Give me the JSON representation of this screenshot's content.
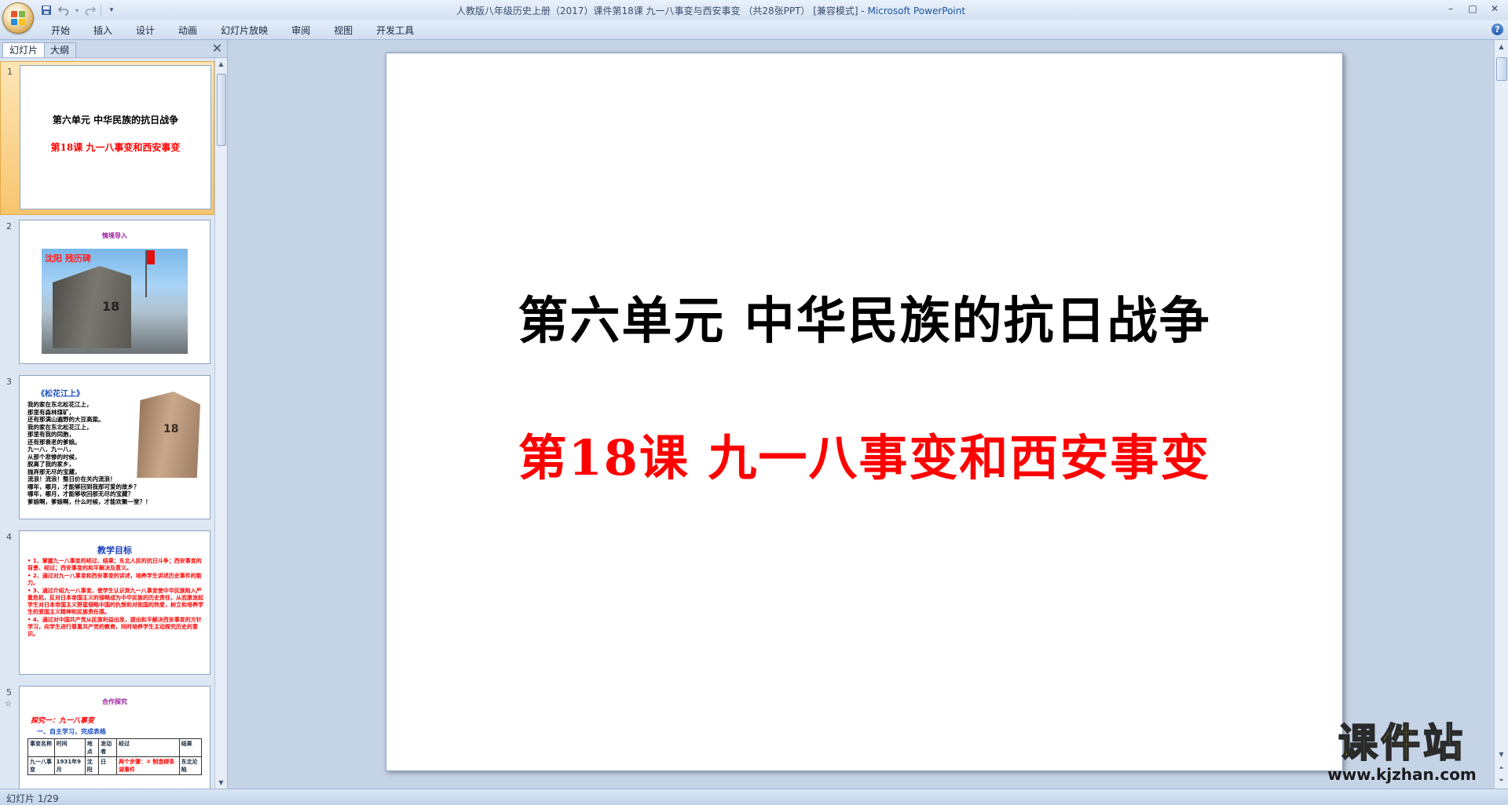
{
  "window": {
    "title": "人教版八年级历史上册（2017）课件第18课 九一八事变与西安事变 （共28张PPT） [兼容模式]",
    "title_sep": " - ",
    "app_name": "Microsoft PowerPoint",
    "minimize": "–",
    "maximize": "□",
    "close": "✕"
  },
  "qat": {
    "save": "save-icon",
    "undo": "undo-icon",
    "redo": "redo-icon",
    "customize": "▾"
  },
  "ribbon": {
    "tabs": [
      "开始",
      "插入",
      "设计",
      "动画",
      "幻灯片放映",
      "审阅",
      "视图",
      "开发工具"
    ],
    "help": "?"
  },
  "panel": {
    "tabs": {
      "slides": "幻灯片",
      "outline": "大纲"
    },
    "close": "✕",
    "thumbnails": [
      {
        "num": "1",
        "line1": "第六单元 中华民族的抗日战争",
        "line2": "第18课 九一八事变和西安事变"
      },
      {
        "num": "2",
        "banner": "情境导入",
        "caption": "沈阳  残历碑",
        "digits": "18"
      },
      {
        "num": "3",
        "title": "《松花江上》",
        "digits": "18",
        "poem": [
          "我的家在东北松花江上，",
          "那里有森林煤矿，",
          "还有那满山遍野的大豆高粱。",
          "我的家在东北松花江上，",
          "那里有我的同胞，",
          "还有那衰老的爹娘。",
          "九一八，九一八，",
          "从那个悲惨的时候，",
          "脱离了我的家乡，",
          "抛弃那无尽的宝藏，",
          "流浪！流浪！整日价在关内流浪！",
          "哪年，哪月，才能够回到我那可爱的故乡？",
          "哪年，哪月，才能够收回那无尽的宝藏？",
          "爹娘啊，爹娘啊，什么时候，才能欢聚一堂？！"
        ]
      },
      {
        "num": "4",
        "title": "教学目标",
        "goals": [
          "• 1、掌握九一八事变的经过、结果；东北人民的抗日斗争；西安事变的背景、经过；西安事变的和平解决及意义。",
          "• 2、通过对九一八事变和西安事变的讲述，培养学生讲述历史事件的能力。",
          "• 3、通过介绍九一八事变，使学生认识到九一八事变使中华民族陷入严重危机，反对日本帝国主义的侵略成为中华民族的历史责任，从而激发起学生对日本帝国主义野蛮侵略中国的仇恨和对祖国的热爱，树立和培养学生的爱国主义精神和民族责任感。",
          "• 4、通过对中国共产党从民族利益出发，提出和平解决西安事变的方针学习，向学生进行尊重共产党的教育，同时培养学生主动探究历史的意识。"
        ]
      },
      {
        "num": "5",
        "anim": "☆",
        "banner": "合作探究",
        "heading": "探究一：九一八事变",
        "sub": "一、自主学习，完成表格",
        "table": {
          "headers": [
            "事变名称",
            "时间",
            "地点",
            "发动者",
            "经过",
            "结果"
          ],
          "row": [
            "九一八事变",
            "1931年9月",
            "沈阳",
            "日",
            "两个步骤：① 制造柳条湖事件",
            "东北沦陷"
          ]
        }
      }
    ]
  },
  "slide": {
    "title": "第六单元  中华民族的抗日战争",
    "subtitle": "第18课  九一八事变和西安事变"
  },
  "status": {
    "text": "幻灯片 1/29"
  },
  "watermark": {
    "cn": "课件站",
    "url": "www.kjzhan.com"
  },
  "colors": {
    "title_red": "#ff0000",
    "title_black": "#000000",
    "accent_blue": "#1c53a0"
  }
}
